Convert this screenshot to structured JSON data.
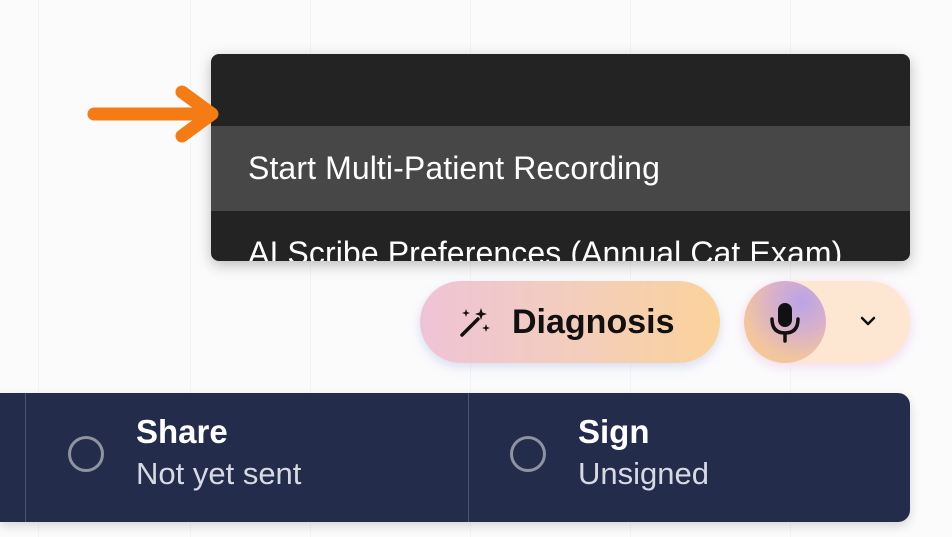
{
  "menu": {
    "items": [
      {
        "label": "Start Multi-Patient Recording",
        "active": true
      },
      {
        "label": "AI Scribe Preferences (Annual Cat Exam)",
        "active": false
      }
    ]
  },
  "toolbar": {
    "diagnosis_label": "Diagnosis",
    "diagnosis_icon": "magic-wand-icon",
    "mic_icon": "microphone-icon",
    "chevron_icon": "chevron-down-icon"
  },
  "status_bar": {
    "items": [
      {
        "title": "Share",
        "subtitle": "Not yet sent"
      },
      {
        "title": "Sign",
        "subtitle": "Unsigned"
      }
    ]
  },
  "colors": {
    "menu_bg": "#232323",
    "menu_active_bg": "#474747",
    "arrow": "#f57c14",
    "status_bar_bg": "#232d4b"
  }
}
